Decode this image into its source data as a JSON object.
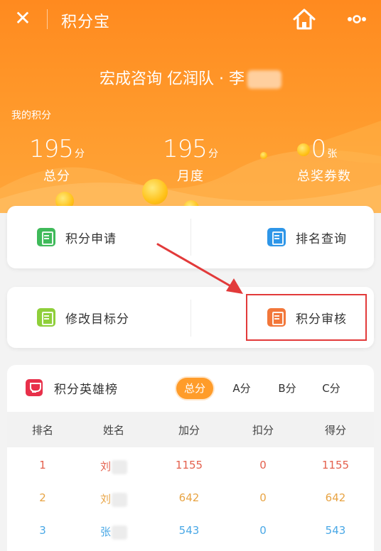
{
  "topbar": {
    "title": "积分宝",
    "close_icon": "close-icon",
    "home_icon": "home-icon",
    "more_icon": "more-dots-icon"
  },
  "profile": {
    "team_text": "宏成咨询 亿润队 · 李",
    "my_points_label": "我的积分"
  },
  "stats": {
    "total": {
      "value": "195",
      "unit": "分",
      "label": "总分"
    },
    "monthly": {
      "value": "195",
      "unit": "分",
      "label": "月度"
    },
    "coupons": {
      "value": "0",
      "unit": "张",
      "label": "总奖券数"
    }
  },
  "menu": {
    "apply": {
      "label": "积分申请",
      "icon": "score-apply-icon",
      "color": "#3fba5a"
    },
    "rank": {
      "label": "排名查询",
      "icon": "rank-query-icon",
      "color": "#2e96e8"
    },
    "target": {
      "label": "修改目标分",
      "icon": "edit-target-icon",
      "color": "#8fcf3a"
    },
    "review": {
      "label": "积分审核",
      "icon": "score-review-icon",
      "color": "#f2773a"
    }
  },
  "leaderboard": {
    "title": "积分英雄榜",
    "tabs": [
      "总分",
      "A分",
      "B分",
      "C分"
    ],
    "active_tab": "总分",
    "columns": [
      "排名",
      "姓名",
      "加分",
      "扣分",
      "得分"
    ],
    "rows": [
      {
        "rank": "1",
        "name": "刘",
        "add": "1155",
        "deduct": "0",
        "score": "1155"
      },
      {
        "rank": "2",
        "name": "刘",
        "add": "642",
        "deduct": "0",
        "score": "642"
      },
      {
        "rank": "3",
        "name": "张",
        "add": "543",
        "deduct": "0",
        "score": "543"
      }
    ]
  },
  "colors": {
    "header_orange": "#ff8a1f",
    "highlight_red": "#e23a3a",
    "rank1": "#e4604d",
    "rank2": "#e8a444",
    "rank3": "#4aa8e6"
  }
}
